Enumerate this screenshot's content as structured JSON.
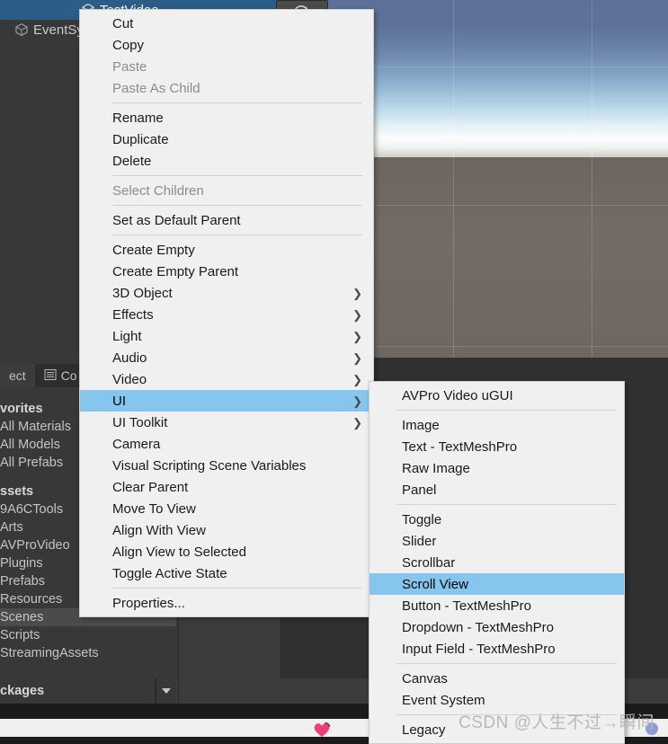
{
  "hierarchy": {
    "items": [
      {
        "label": "TestVideo",
        "icon": "cube-icon",
        "selected": true,
        "indent": 1
      },
      {
        "label": "EventSystem",
        "icon": "cube-icon",
        "selected": false,
        "indent": 0
      }
    ]
  },
  "scene_view": {
    "sky_top_color": "#5c7099",
    "sky_horizon_color": "#fbfdfd",
    "ground_color": "#6d665f",
    "grid_color": "#ffffff"
  },
  "project_panel": {
    "tabs": [
      {
        "label": "ect",
        "full_label": "Project",
        "icon": "project-icon",
        "active": true
      },
      {
        "label": "Co",
        "full_label": "Console",
        "icon": "console-list-icon",
        "active": false
      }
    ],
    "tree": [
      {
        "label": "vorites",
        "full_label": "Favorites",
        "header": true,
        "selected": false
      },
      {
        "label": "All Materials",
        "header": false,
        "selected": false
      },
      {
        "label": "All Models",
        "header": false,
        "selected": false
      },
      {
        "label": "All Prefabs",
        "header": false,
        "selected": false
      },
      {
        "label": "ssets",
        "full_label": "Assets",
        "header": true,
        "selected": false
      },
      {
        "label": "9A6CTools",
        "header": false,
        "selected": false
      },
      {
        "label": "Arts",
        "header": false,
        "selected": false
      },
      {
        "label": "AVProVideo",
        "header": false,
        "selected": false
      },
      {
        "label": "Plugins",
        "header": false,
        "selected": false
      },
      {
        "label": "Prefabs",
        "header": false,
        "selected": false
      },
      {
        "label": "Resources",
        "header": false,
        "selected": false
      },
      {
        "label": "Scenes",
        "header": false,
        "selected": true
      },
      {
        "label": "Scripts",
        "header": false,
        "selected": false
      },
      {
        "label": "StreamingAssets",
        "header": false,
        "selected": false
      }
    ],
    "footer_label": "ckages",
    "footer_full_label": "Packages"
  },
  "context_menu": {
    "highlight_color": "#86c5ee",
    "items": [
      {
        "label": "Cut",
        "type": "item"
      },
      {
        "label": "Copy",
        "type": "item"
      },
      {
        "label": "Paste",
        "type": "item",
        "disabled": true
      },
      {
        "label": "Paste As Child",
        "type": "item",
        "disabled": true
      },
      {
        "type": "separator"
      },
      {
        "label": "Rename",
        "type": "item"
      },
      {
        "label": "Duplicate",
        "type": "item"
      },
      {
        "label": "Delete",
        "type": "item"
      },
      {
        "type": "separator"
      },
      {
        "label": "Select Children",
        "type": "item",
        "disabled": true
      },
      {
        "type": "separator"
      },
      {
        "label": "Set as Default Parent",
        "type": "item"
      },
      {
        "type": "separator"
      },
      {
        "label": "Create Empty",
        "type": "item"
      },
      {
        "label": "Create Empty Parent",
        "type": "item"
      },
      {
        "label": "3D Object",
        "type": "item",
        "submenu": true
      },
      {
        "label": "Effects",
        "type": "item",
        "submenu": true
      },
      {
        "label": "Light",
        "type": "item",
        "submenu": true
      },
      {
        "label": "Audio",
        "type": "item",
        "submenu": true
      },
      {
        "label": "Video",
        "type": "item",
        "submenu": true
      },
      {
        "label": "UI",
        "type": "item",
        "submenu": true,
        "selected": true
      },
      {
        "label": "UI Toolkit",
        "type": "item",
        "submenu": true
      },
      {
        "label": "Camera",
        "type": "item"
      },
      {
        "label": "Visual Scripting Scene Variables",
        "type": "item"
      },
      {
        "label": "Clear Parent",
        "type": "item"
      },
      {
        "label": "Move To View",
        "type": "item"
      },
      {
        "label": "Align With View",
        "type": "item"
      },
      {
        "label": "Align View to Selected",
        "type": "item"
      },
      {
        "label": "Toggle Active State",
        "type": "item"
      },
      {
        "type": "separator"
      },
      {
        "label": "Properties...",
        "type": "item"
      }
    ]
  },
  "ui_submenu": {
    "items": [
      {
        "label": "AVPro Video uGUI",
        "type": "item"
      },
      {
        "type": "separator"
      },
      {
        "label": "Image",
        "type": "item"
      },
      {
        "label": "Text - TextMeshPro",
        "type": "item"
      },
      {
        "label": "Raw Image",
        "type": "item"
      },
      {
        "label": "Panel",
        "type": "item"
      },
      {
        "type": "separator"
      },
      {
        "label": "Toggle",
        "type": "item"
      },
      {
        "label": "Slider",
        "type": "item"
      },
      {
        "label": "Scrollbar",
        "type": "item"
      },
      {
        "label": "Scroll View",
        "type": "item",
        "selected": true
      },
      {
        "label": "Button - TextMeshPro",
        "type": "item"
      },
      {
        "label": "Dropdown - TextMeshPro",
        "type": "item"
      },
      {
        "label": "Input Field - TextMeshPro",
        "type": "item"
      },
      {
        "type": "separator"
      },
      {
        "label": "Canvas",
        "type": "item"
      },
      {
        "label": "Event System",
        "type": "item"
      },
      {
        "type": "separator"
      },
      {
        "label": "Legacy",
        "type": "item"
      }
    ]
  },
  "watermark": {
    "text": "CSDN @人生不过→瞬间"
  }
}
